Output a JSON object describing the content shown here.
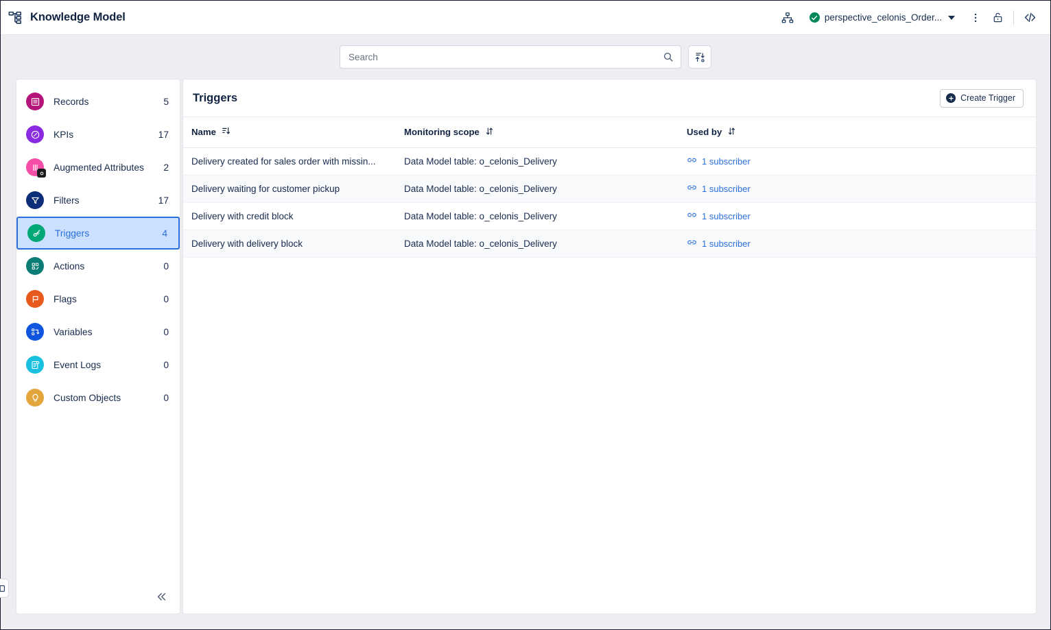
{
  "window": {
    "title": "Knowledge Model",
    "app_icon": "hierarchy-icon"
  },
  "topbar": {
    "share_icon": "org-chart-icon",
    "perspective": {
      "status_icon": "check-circle-icon",
      "label": "perspective_celonis_Order...",
      "caret_icon": "chevron-down-icon"
    },
    "more_icon": "kebab-menu-icon",
    "lock_icon": "unlock-icon",
    "code_icon": "code-brackets-icon"
  },
  "search": {
    "placeholder": "Search",
    "value": "",
    "search_icon": "search-icon",
    "sort_button_icon": "sort-arrows-icon"
  },
  "sidebar": {
    "collapse_icon": "chevron-double-left-icon",
    "edge_toggle_icon": "panel-toggle-icon",
    "items": [
      {
        "label": "Records",
        "count": "5",
        "icon": "records-icon",
        "color": "#b4137a",
        "active": false
      },
      {
        "label": "KPIs",
        "count": "17",
        "icon": "kpi-icon",
        "color": "#8a2be2",
        "active": false
      },
      {
        "label": "Augmented Attributes",
        "count": "2",
        "icon": "augmented-icon",
        "color": "#f54ea8",
        "active": false
      },
      {
        "label": "Filters",
        "count": "17",
        "icon": "filter-icon",
        "color": "#0d2f7a",
        "active": false
      },
      {
        "label": "Triggers",
        "count": "4",
        "icon": "trigger-icon",
        "color": "#00a878",
        "active": true
      },
      {
        "label": "Actions",
        "count": "0",
        "icon": "actions-icon",
        "color": "#0b7d75",
        "active": false
      },
      {
        "label": "Flags",
        "count": "0",
        "icon": "flag-icon",
        "color": "#e8591d",
        "active": false
      },
      {
        "label": "Variables",
        "count": "0",
        "icon": "variables-icon",
        "color": "#1055e0",
        "active": false
      },
      {
        "label": "Event Logs",
        "count": "0",
        "icon": "event-logs-icon",
        "color": "#19c0e0",
        "active": false
      },
      {
        "label": "Custom Objects",
        "count": "0",
        "icon": "lightbulb-icon",
        "color": "#e3a63c",
        "active": false
      }
    ]
  },
  "main": {
    "title": "Triggers",
    "create_button": {
      "label": "Create Trigger",
      "icon": "plus-circle-icon"
    },
    "table": {
      "columns": [
        {
          "label": "Name",
          "sort_icon": "sort-descending-icon"
        },
        {
          "label": "Monitoring scope",
          "sort_icon": "sort-updown-icon"
        },
        {
          "label": "Used by",
          "sort_icon": "sort-updown-icon"
        }
      ],
      "rows": [
        {
          "name": "Delivery created for sales order with missin...",
          "scope": "Data Model table: o_celonis_Delivery",
          "used_by": "1 subscriber",
          "used_by_icon": "link-icon"
        },
        {
          "name": "Delivery waiting for customer pickup",
          "scope": "Data Model table: o_celonis_Delivery",
          "used_by": "1 subscriber",
          "used_by_icon": "link-icon"
        },
        {
          "name": "Delivery with credit block",
          "scope": "Data Model table: o_celonis_Delivery",
          "used_by": "1 subscriber",
          "used_by_icon": "link-icon"
        },
        {
          "name": "Delivery with delivery block",
          "scope": "Data Model table: o_celonis_Delivery",
          "used_by": "1 subscriber",
          "used_by_icon": "link-icon"
        }
      ]
    }
  },
  "colors": {
    "accent": "#2a6fdb",
    "text": "#172b4d",
    "page_bg": "#eeeef2"
  }
}
